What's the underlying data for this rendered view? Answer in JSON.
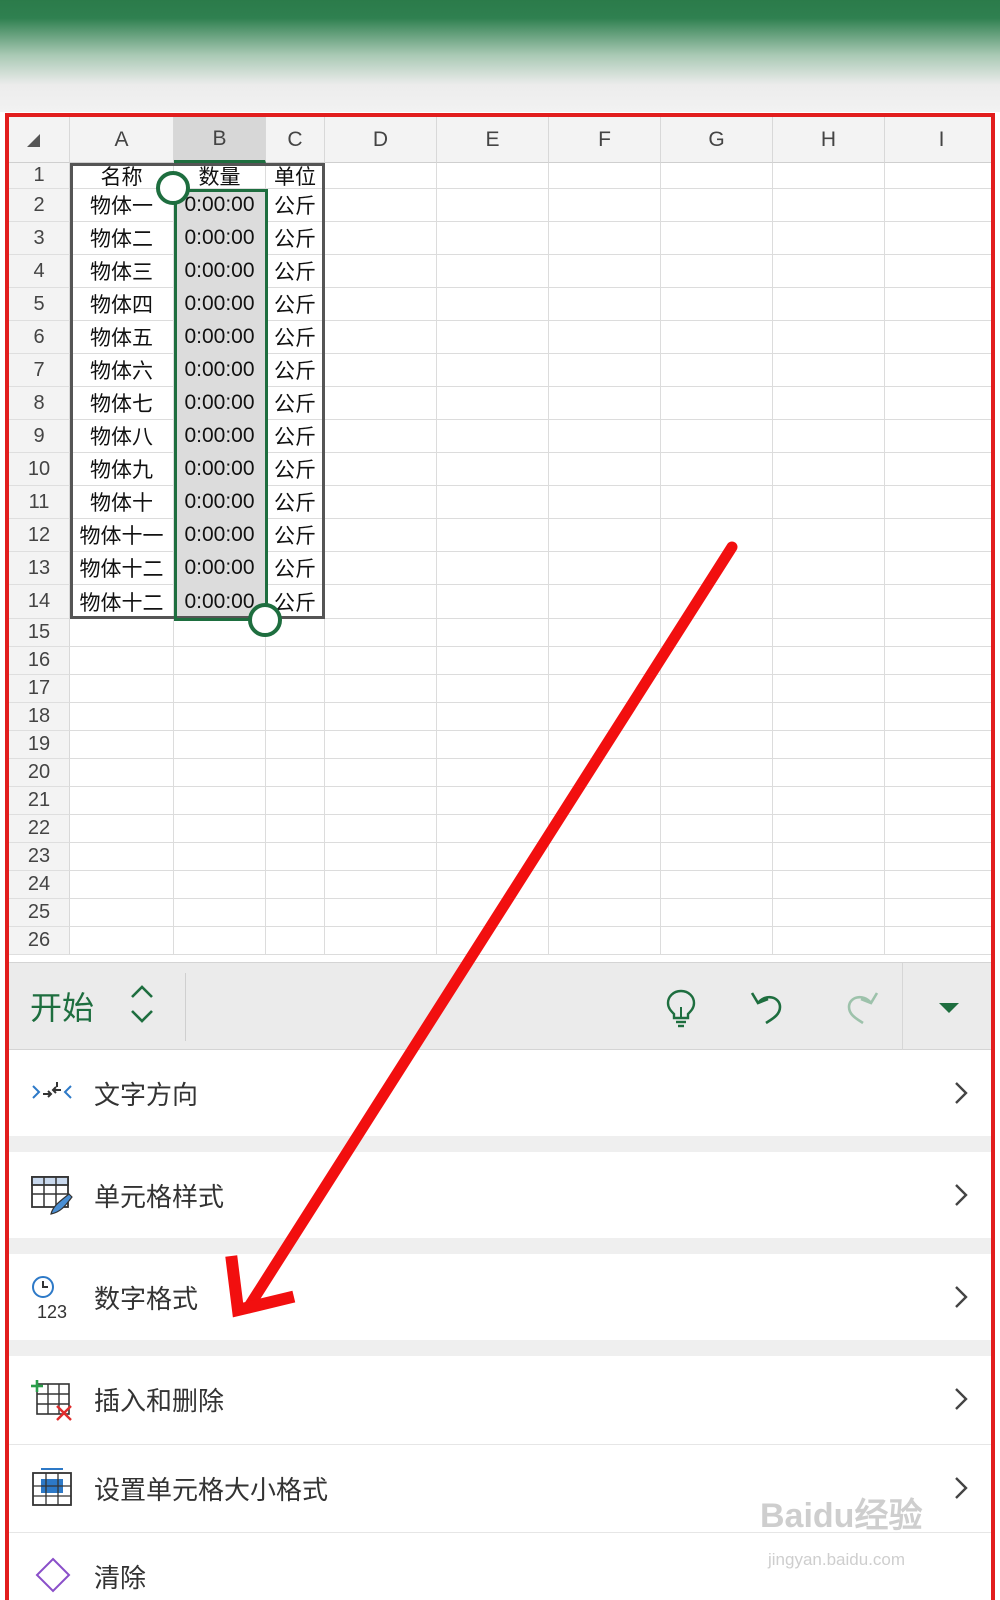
{
  "sheet": {
    "columns": [
      "A",
      "B",
      "C",
      "D",
      "E",
      "F",
      "G",
      "H",
      "I"
    ],
    "rows": [
      "1",
      "2",
      "3",
      "4",
      "5",
      "6",
      "7",
      "8",
      "9",
      "10",
      "11",
      "12",
      "13",
      "14",
      "15",
      "16",
      "17",
      "18",
      "19",
      "20",
      "21",
      "22",
      "23",
      "24",
      "25",
      "26"
    ],
    "header_row": [
      "名称",
      "数量",
      "单位"
    ],
    "data_rows": [
      [
        "物体一",
        "0:00:00",
        "公斤"
      ],
      [
        "物体二",
        "0:00:00",
        "公斤"
      ],
      [
        "物体三",
        "0:00:00",
        "公斤"
      ],
      [
        "物体四",
        "0:00:00",
        "公斤"
      ],
      [
        "物体五",
        "0:00:00",
        "公斤"
      ],
      [
        "物体六",
        "0:00:00",
        "公斤"
      ],
      [
        "物体七",
        "0:00:00",
        "公斤"
      ],
      [
        "物体八",
        "0:00:00",
        "公斤"
      ],
      [
        "物体九",
        "0:00:00",
        "公斤"
      ],
      [
        "物体十",
        "0:00:00",
        "公斤"
      ],
      [
        "物体十一",
        "0:00:00",
        "公斤"
      ],
      [
        "物体十二",
        "0:00:00",
        "公斤"
      ],
      [
        "物体十二",
        "0:00:00",
        "公斤"
      ]
    ],
    "selected_column": "B"
  },
  "toolbar": {
    "tab_label": "开始",
    "icons": [
      "tab-switch-icon",
      "lightbulb-icon",
      "undo-icon",
      "redo-icon",
      "collapse-dropdown-icon"
    ]
  },
  "menu": {
    "items": [
      {
        "label": "文字方向",
        "icon": "text-direction-icon"
      },
      {
        "label": "单元格样式",
        "icon": "cell-styles-icon"
      },
      {
        "label": "数字格式",
        "icon": "number-format-icon"
      },
      {
        "label": "插入和删除",
        "icon": "insert-delete-icon"
      },
      {
        "label": "设置单元格大小格式",
        "icon": "cell-size-icon"
      },
      {
        "label": "清除",
        "icon": "clear-icon"
      }
    ]
  },
  "watermark": {
    "text": "Baidu经验",
    "sub": "jingyan.baidu.com"
  },
  "colors": {
    "excel_green": "#1e6e3f",
    "annotation_red": "#e21d1d"
  }
}
